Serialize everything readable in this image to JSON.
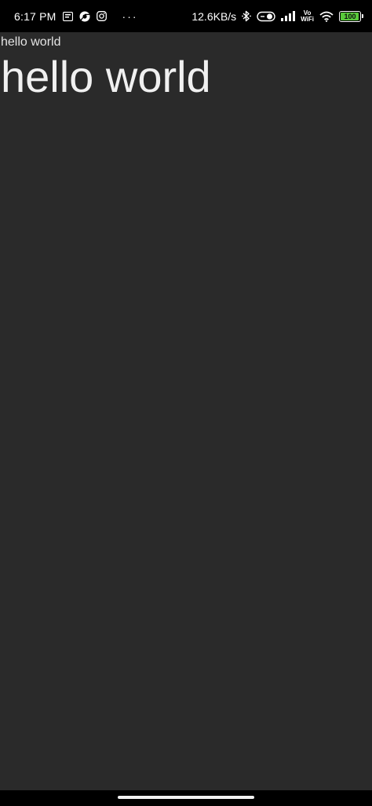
{
  "status_bar": {
    "time": "6:17 PM",
    "more_indicator": "···",
    "network_speed": "12.6KB/s",
    "volte_top": "Vo",
    "volte_bottom": "WiFi",
    "battery_percent": 100,
    "battery_label": "100",
    "battery_color": "#59c93b",
    "icons": [
      "notification-icon",
      "chrome-icon",
      "instagram-icon",
      "bluetooth-icon",
      "toggle-icon",
      "signal-icon",
      "wifi-icon",
      "battery-icon"
    ]
  },
  "content": {
    "small_text": "hello world",
    "large_text": "hello world"
  },
  "colors": {
    "background": "#2a2a2a",
    "status_bar": "#000000",
    "text": "#f0f0f0"
  }
}
